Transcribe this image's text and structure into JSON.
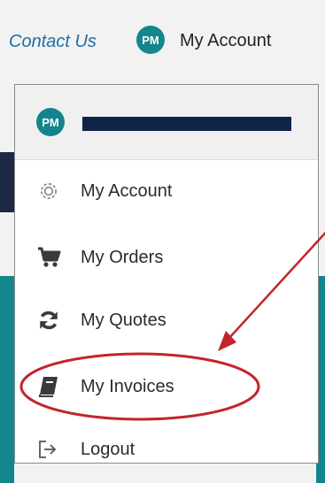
{
  "header": {
    "contact_label": "Contact Us",
    "account_initials": "PM",
    "account_label": "My Account"
  },
  "menu": {
    "initials": "PM",
    "items": [
      {
        "label": "My Account",
        "icon": "gear-icon"
      },
      {
        "label": "My Orders",
        "icon": "cart-icon"
      },
      {
        "label": "My Quotes",
        "icon": "refresh-icon"
      },
      {
        "label": "My Invoices",
        "icon": "book-icon"
      },
      {
        "label": "Logout",
        "icon": "logout-icon"
      }
    ]
  },
  "colors": {
    "teal": "#13858d",
    "navy": "#10244a",
    "link": "#1f6ea3",
    "annotation": "#c3242c"
  }
}
